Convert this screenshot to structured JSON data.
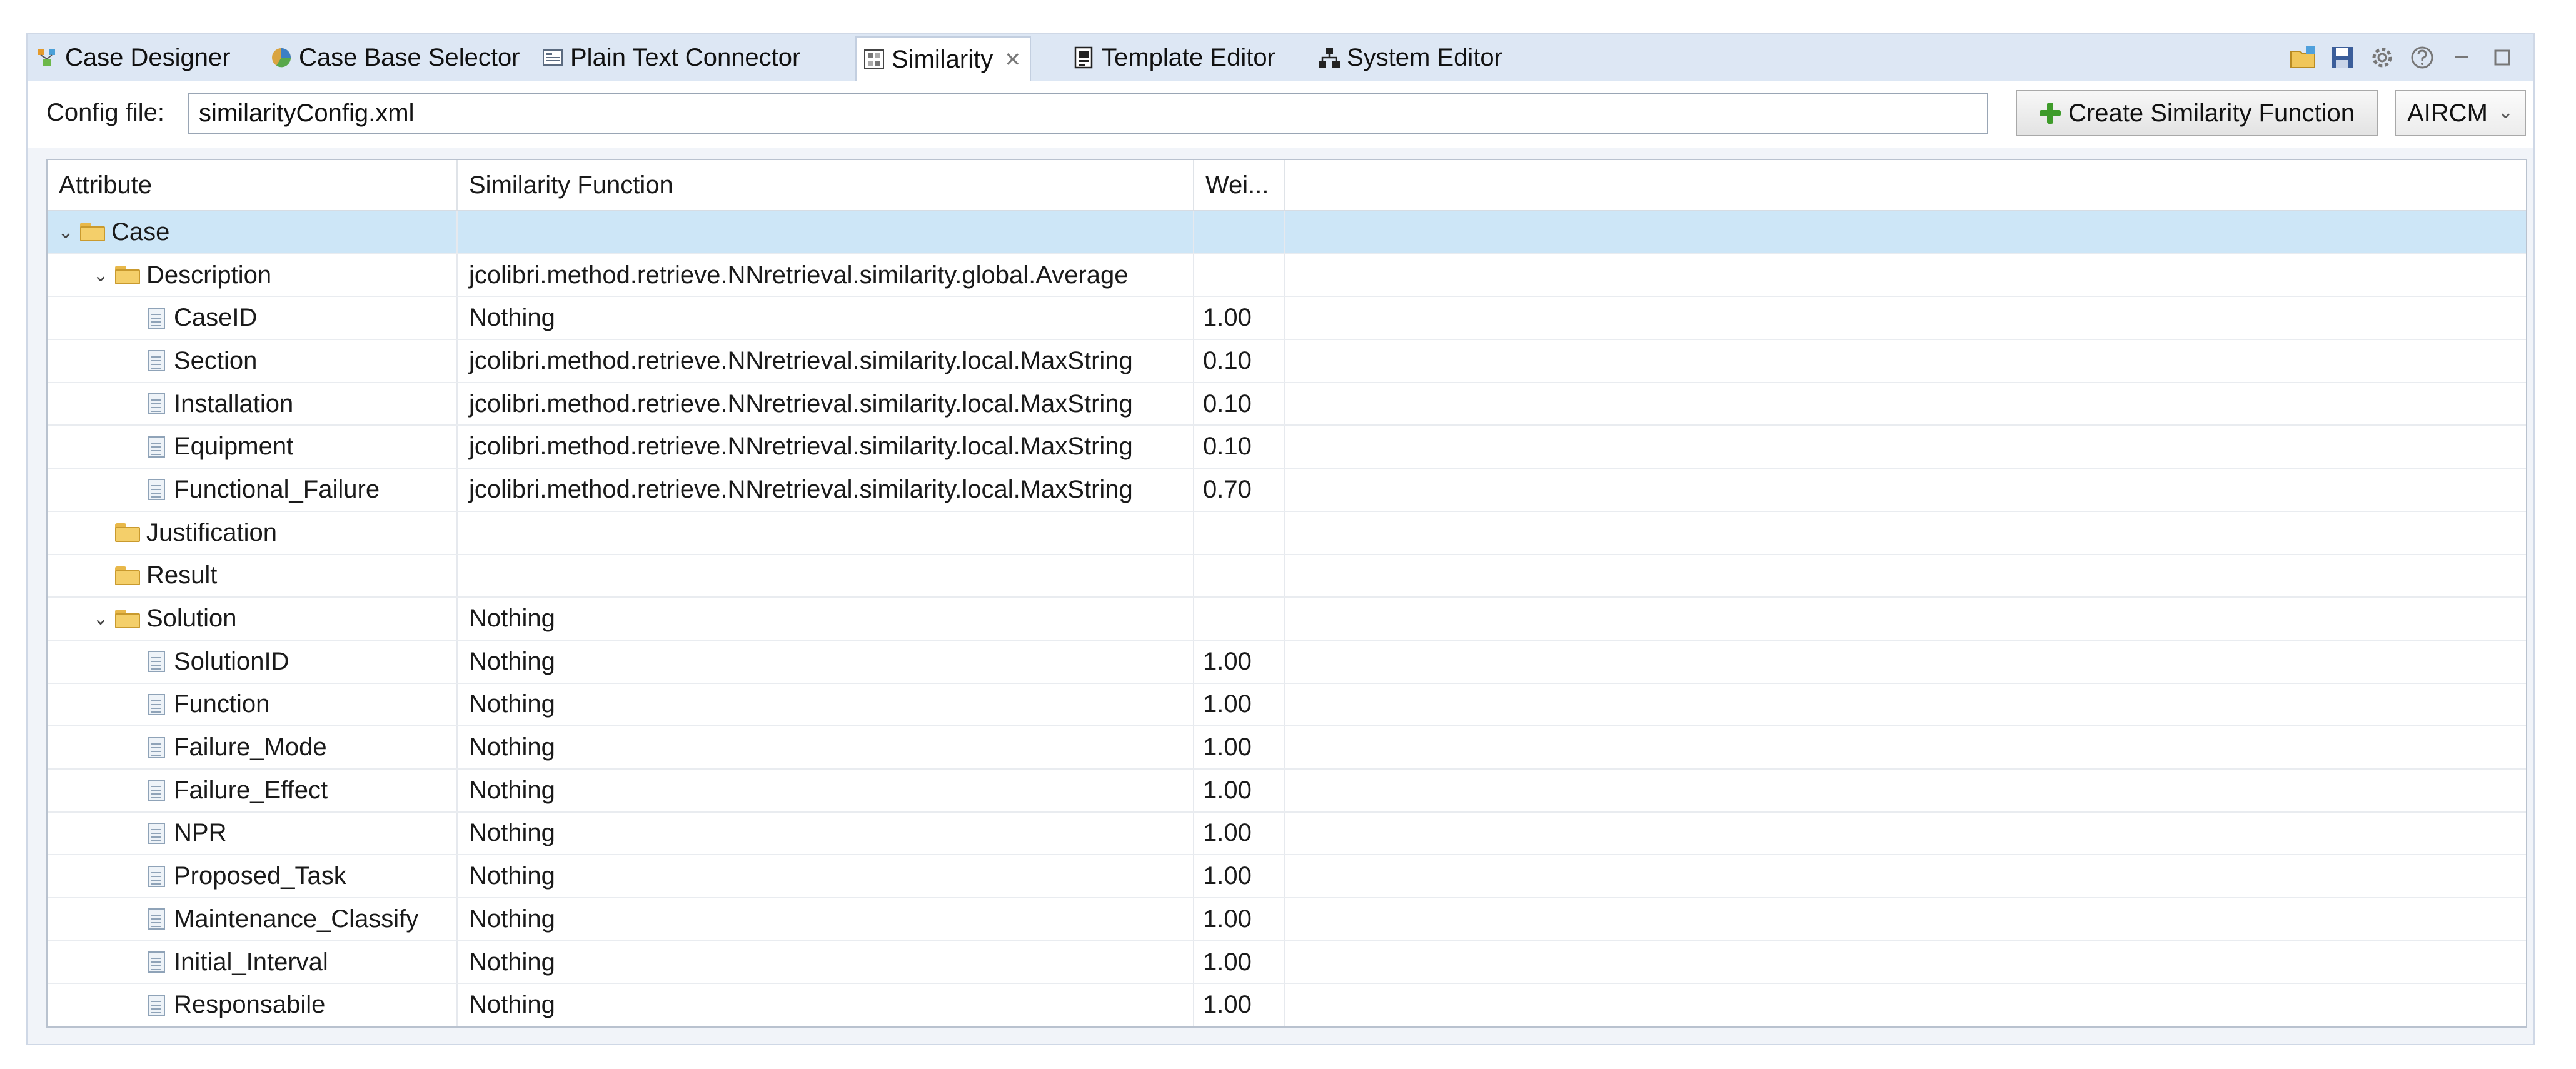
{
  "tabs": [
    {
      "label": "Case Designer",
      "icon": "case-designer-icon"
    },
    {
      "label": "Case Base Selector",
      "icon": "case-base-selector-icon"
    },
    {
      "label": "Plain Text Connector",
      "icon": "plain-text-connector-icon"
    },
    {
      "label": "Similarity",
      "icon": "similarity-icon",
      "active": true,
      "close": "✕"
    },
    {
      "label": "Template Editor",
      "icon": "template-editor-icon"
    },
    {
      "label": "System Editor",
      "icon": "system-editor-icon"
    }
  ],
  "config": {
    "label": "Config file:",
    "value": "similarityConfig.xml",
    "create_button": "Create Similarity Function",
    "select_value": "AIRCM"
  },
  "table": {
    "headers": [
      "Attribute",
      "Similarity Function",
      "Wei..."
    ],
    "rows": [
      {
        "level": 0,
        "type": "folder",
        "expanded": true,
        "name": "Case",
        "func": "",
        "weight": "",
        "selected": true
      },
      {
        "level": 1,
        "type": "folder",
        "expanded": true,
        "name": "Description",
        "func": "jcolibri.method.retrieve.NNretrieval.similarity.global.Average",
        "weight": ""
      },
      {
        "level": 2,
        "type": "file",
        "name": "CaseID",
        "func": "Nothing",
        "weight": "1.00"
      },
      {
        "level": 2,
        "type": "file",
        "name": "Section",
        "func": "jcolibri.method.retrieve.NNretrieval.similarity.local.MaxString",
        "weight": "0.10"
      },
      {
        "level": 2,
        "type": "file",
        "name": "Installation",
        "func": "jcolibri.method.retrieve.NNretrieval.similarity.local.MaxString",
        "weight": "0.10"
      },
      {
        "level": 2,
        "type": "file",
        "name": "Equipment",
        "func": "jcolibri.method.retrieve.NNretrieval.similarity.local.MaxString",
        "weight": "0.10"
      },
      {
        "level": 2,
        "type": "file",
        "name": "Functional_Failure",
        "func": "jcolibri.method.retrieve.NNretrieval.similarity.local.MaxString",
        "weight": "0.70"
      },
      {
        "level": 1,
        "type": "folder",
        "expanded": false,
        "name": "Justification",
        "func": "",
        "weight": ""
      },
      {
        "level": 1,
        "type": "folder",
        "expanded": false,
        "name": "Result",
        "func": "",
        "weight": ""
      },
      {
        "level": 1,
        "type": "folder",
        "expanded": true,
        "name": "Solution",
        "func": "Nothing",
        "weight": ""
      },
      {
        "level": 2,
        "type": "file",
        "name": "SolutionID",
        "func": "Nothing",
        "weight": "1.00"
      },
      {
        "level": 2,
        "type": "file",
        "name": "Function",
        "func": "Nothing",
        "weight": "1.00"
      },
      {
        "level": 2,
        "type": "file",
        "name": "Failure_Mode",
        "func": "Nothing",
        "weight": "1.00"
      },
      {
        "level": 2,
        "type": "file",
        "name": "Failure_Effect",
        "func": "Nothing",
        "weight": "1.00"
      },
      {
        "level": 2,
        "type": "file",
        "name": "NPR",
        "func": "Nothing",
        "weight": "1.00"
      },
      {
        "level": 2,
        "type": "file",
        "name": "Proposed_Task",
        "func": "Nothing",
        "weight": "1.00"
      },
      {
        "level": 2,
        "type": "file",
        "name": "Maintenance_Classify",
        "func": "Nothing",
        "weight": "1.00"
      },
      {
        "level": 2,
        "type": "file",
        "name": "Initial_Interval",
        "func": "Nothing",
        "weight": "1.00"
      },
      {
        "level": 2,
        "type": "file",
        "name": "Responsabile",
        "func": "Nothing",
        "weight": "1.00"
      },
      {
        "level": 0,
        "type": "empty",
        "name": "",
        "func": "",
        "weight": ""
      }
    ]
  },
  "toolbar_icons": [
    "new-folder-icon",
    "save-icon",
    "settings-icon",
    "help-icon",
    "minimize-icon",
    "maximize-icon"
  ],
  "colors": {
    "accent": "#cde6f7",
    "tabbar": "#dde7f4"
  }
}
